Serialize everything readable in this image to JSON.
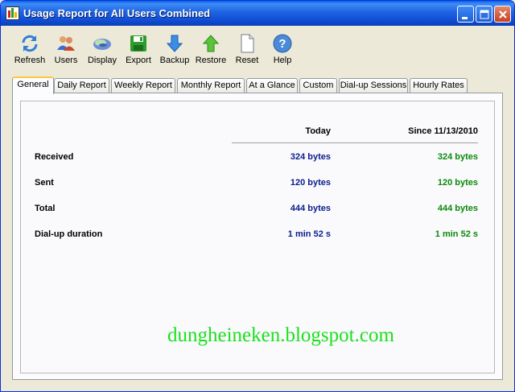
{
  "window": {
    "title": "Usage Report for All Users Combined"
  },
  "toolbar": {
    "items": [
      {
        "id": "refresh",
        "label": "Refresh",
        "icon": "refresh-icon"
      },
      {
        "id": "users",
        "label": "Users",
        "icon": "users-icon"
      },
      {
        "id": "display",
        "label": "Display",
        "icon": "display-icon"
      },
      {
        "id": "export",
        "label": "Export",
        "icon": "save-disk-icon"
      },
      {
        "id": "backup",
        "label": "Backup",
        "icon": "arrow-down-icon"
      },
      {
        "id": "restore",
        "label": "Restore",
        "icon": "arrow-up-icon"
      },
      {
        "id": "reset",
        "label": "Reset",
        "icon": "blank-page-icon"
      },
      {
        "id": "help",
        "label": "Help",
        "icon": "help-icon"
      }
    ]
  },
  "tabs": [
    "General",
    "Daily Report",
    "Weekly Report",
    "Monthly Report",
    "At a Glance",
    "Custom",
    "Dial-up Sessions",
    "Hourly Rates"
  ],
  "active_tab": "General",
  "report": {
    "col_today": "Today",
    "col_since": "Since 11/13/2010",
    "rows": [
      {
        "label": "Received",
        "today": "324 bytes",
        "since": "324 bytes"
      },
      {
        "label": "Sent",
        "today": "120 bytes",
        "since": "120 bytes"
      },
      {
        "label": "Total",
        "today": "444 bytes",
        "since": "444 bytes"
      },
      {
        "label": "Dial-up duration",
        "today": "1 min 52 s",
        "since": "1 min 52 s"
      }
    ]
  },
  "watermark": "dungheineken.blogspot.com",
  "colors": {
    "today_value": "#0a1e8c",
    "since_value": "#0a8a0a",
    "watermark": "#1ce01c",
    "titlebar": "#0f4cd3"
  }
}
